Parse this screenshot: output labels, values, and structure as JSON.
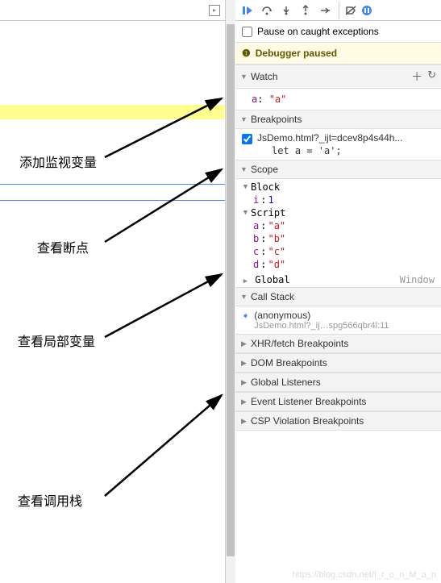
{
  "checkbox": {
    "label": "Pause on caught exceptions"
  },
  "paused": {
    "text": "Debugger paused"
  },
  "watch": {
    "title": "Watch",
    "items": [
      {
        "name": "a",
        "value": "\"a\""
      }
    ]
  },
  "breakpoints": {
    "title": "Breakpoints",
    "items": [
      {
        "file": "JsDemo.html?_ijt=dcev8p4s44h...",
        "code": "let a = 'a';",
        "checked": true
      }
    ]
  },
  "scope": {
    "title": "Scope",
    "block": {
      "label": "Block",
      "vars": [
        {
          "name": "i",
          "value": "1",
          "type": "num"
        }
      ]
    },
    "script": {
      "label": "Script",
      "vars": [
        {
          "name": "a",
          "value": "\"a\""
        },
        {
          "name": "b",
          "value": "\"b\""
        },
        {
          "name": "c",
          "value": "\"c\""
        },
        {
          "name": "d",
          "value": "\"d\""
        }
      ]
    },
    "global": {
      "label": "Global",
      "type": "Window"
    }
  },
  "callstack": {
    "title": "Call Stack",
    "items": [
      {
        "name": "(anonymous)",
        "file": "JsDemo.html?_ij…spg566qbr4l:11"
      }
    ]
  },
  "sections": {
    "xhr": "XHR/fetch Breakpoints",
    "dom": "DOM Breakpoints",
    "global_listeners": "Global Listeners",
    "event": "Event Listener Breakpoints",
    "csp": "CSP Violation Breakpoints"
  },
  "annotations": {
    "a1": "添加监视变量",
    "a2": "查看断点",
    "a3": "查看局部变量",
    "a4": "查看调用栈"
  },
  "watermark": "https://blog.csdn.net/I_r_o_n_M_a_n"
}
